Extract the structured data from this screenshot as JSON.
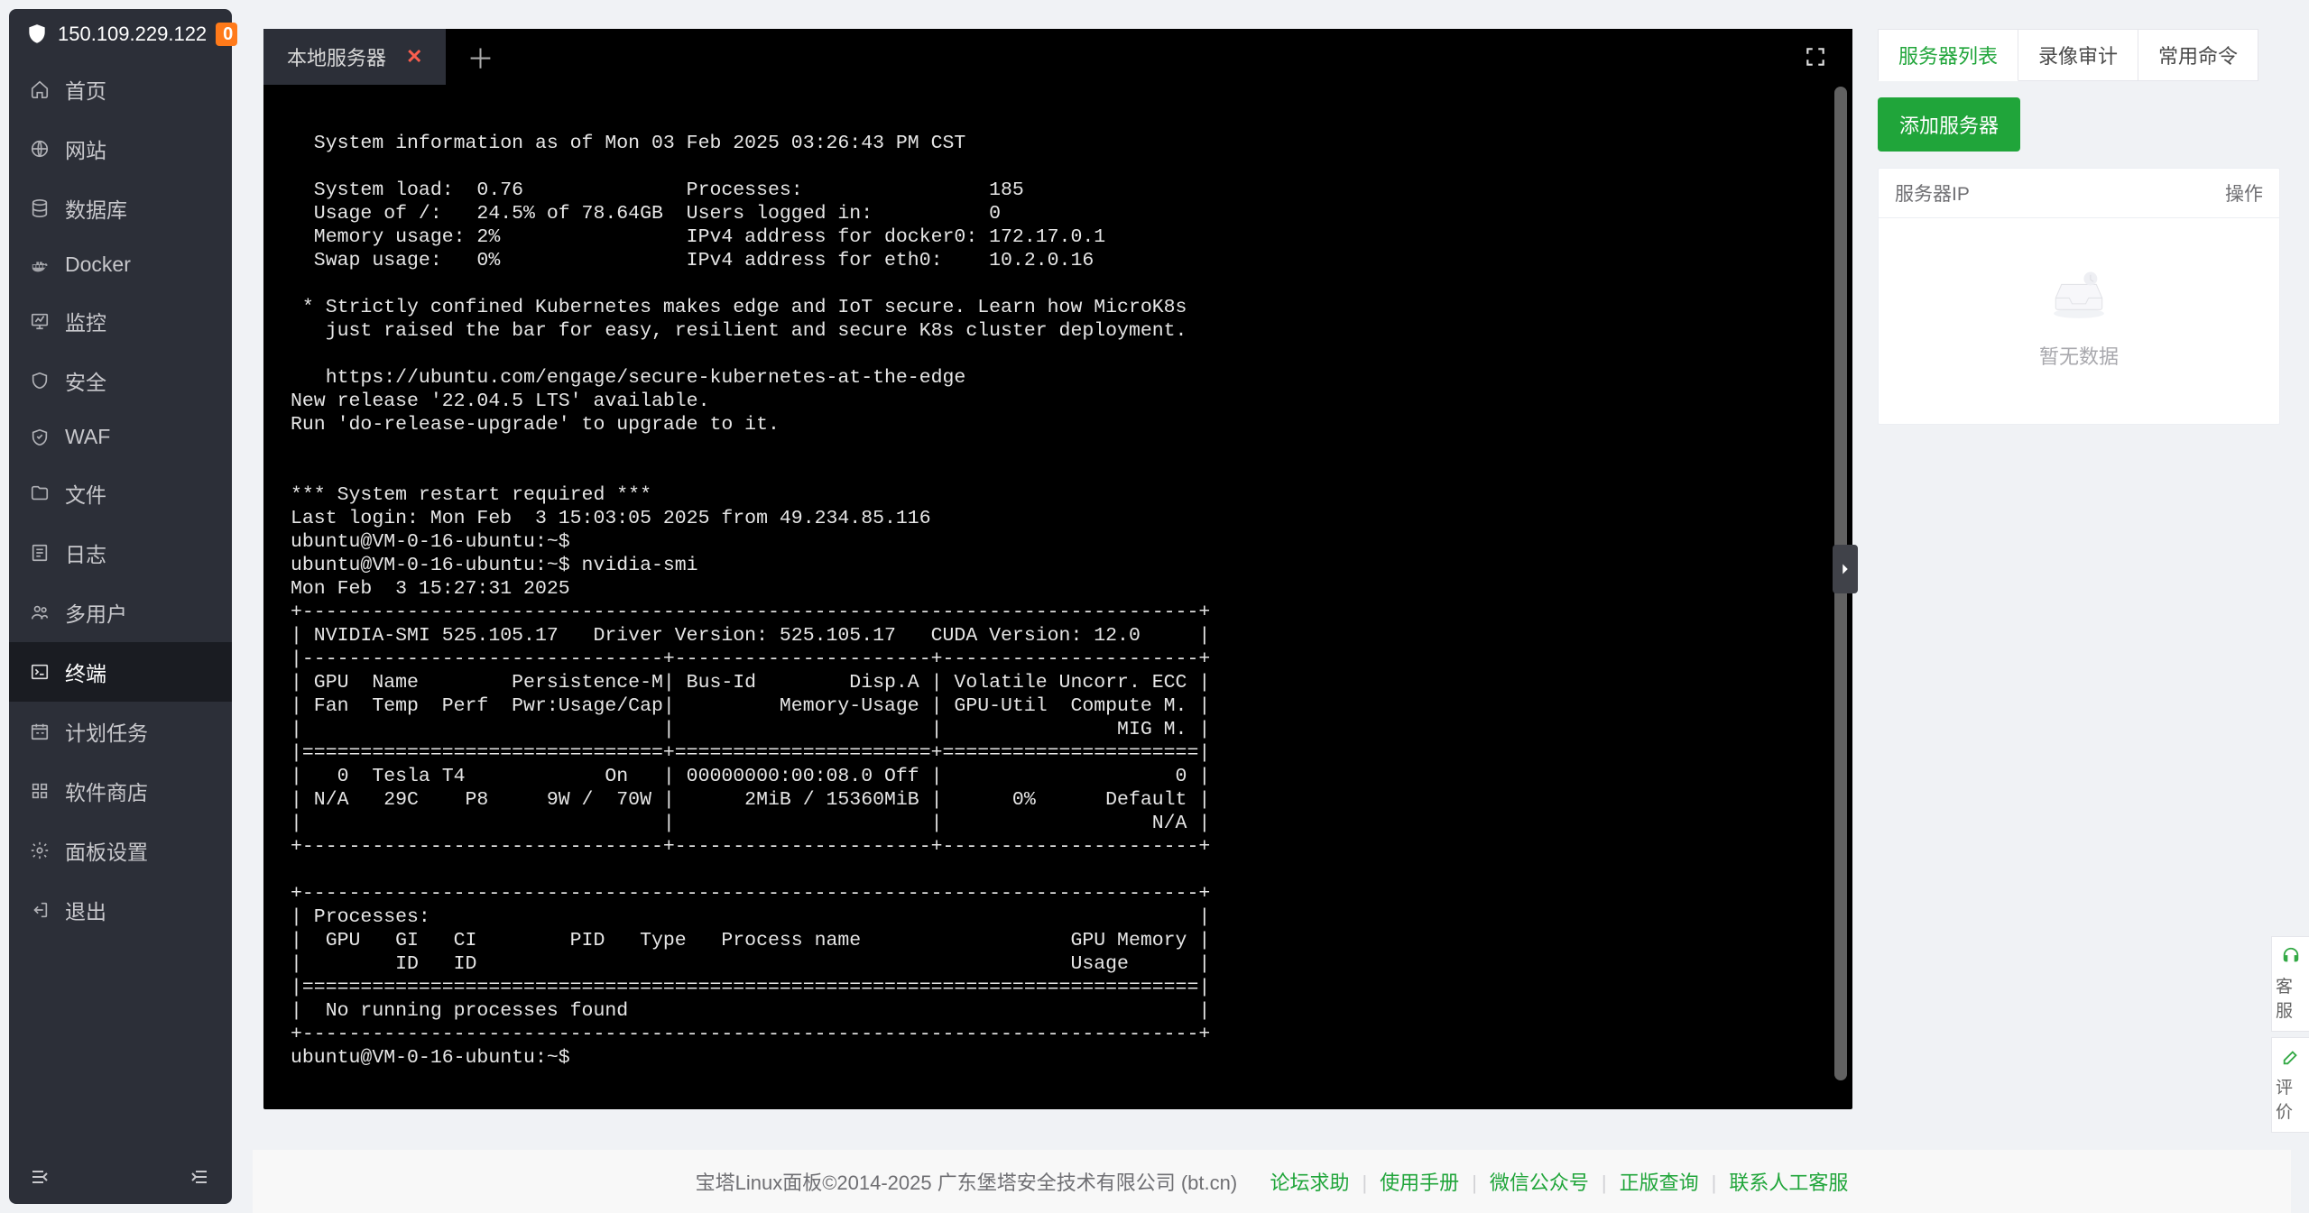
{
  "sidebar": {
    "ip": "150.109.229.122",
    "badge": "0",
    "items": [
      {
        "label": "首页",
        "icon": "home-icon"
      },
      {
        "label": "网站",
        "icon": "globe-icon"
      },
      {
        "label": "数据库",
        "icon": "database-icon"
      },
      {
        "label": "Docker",
        "icon": "docker-icon"
      },
      {
        "label": "监控",
        "icon": "monitor-icon"
      },
      {
        "label": "安全",
        "icon": "shield-icon"
      },
      {
        "label": "WAF",
        "icon": "waf-icon"
      },
      {
        "label": "文件",
        "icon": "folder-icon"
      },
      {
        "label": "日志",
        "icon": "log-icon"
      },
      {
        "label": "多用户",
        "icon": "users-icon"
      },
      {
        "label": "终端",
        "icon": "terminal-icon",
        "active": true
      },
      {
        "label": "计划任务",
        "icon": "schedule-icon"
      },
      {
        "label": "软件商店",
        "icon": "apps-icon"
      },
      {
        "label": "面板设置",
        "icon": "settings-icon"
      },
      {
        "label": "退出",
        "icon": "logout-icon"
      }
    ]
  },
  "terminal": {
    "tab_label": "本地服务器",
    "output": "\n  System information as of Mon 03 Feb 2025 03:26:43 PM CST\n\n  System load:  0.76              Processes:                185\n  Usage of /:   24.5% of 78.64GB  Users logged in:          0\n  Memory usage: 2%                IPv4 address for docker0: 172.17.0.1\n  Swap usage:   0%                IPv4 address for eth0:    10.2.0.16\n\n * Strictly confined Kubernetes makes edge and IoT secure. Learn how MicroK8s\n   just raised the bar for easy, resilient and secure K8s cluster deployment.\n\n   https://ubuntu.com/engage/secure-kubernetes-at-the-edge\nNew release '22.04.5 LTS' available.\nRun 'do-release-upgrade' to upgrade to it.\n\n\n*** System restart required ***\nLast login: Mon Feb  3 15:03:05 2025 from 49.234.85.116\nubuntu@VM-0-16-ubuntu:~$ \nubuntu@VM-0-16-ubuntu:~$ nvidia-smi\nMon Feb  3 15:27:31 2025       \n+-----------------------------------------------------------------------------+\n| NVIDIA-SMI 525.105.17   Driver Version: 525.105.17   CUDA Version: 12.0     |\n|-------------------------------+----------------------+----------------------+\n| GPU  Name        Persistence-M| Bus-Id        Disp.A | Volatile Uncorr. ECC |\n| Fan  Temp  Perf  Pwr:Usage/Cap|         Memory-Usage | GPU-Util  Compute M. |\n|                               |                      |               MIG M. |\n|===============================+======================+======================|\n|   0  Tesla T4            On   | 00000000:00:08.0 Off |                    0 |\n| N/A   29C    P8     9W /  70W |      2MiB / 15360MiB |      0%      Default |\n|                               |                      |                  N/A |\n+-------------------------------+----------------------+----------------------+\n                                                                               \n+-----------------------------------------------------------------------------+\n| Processes:                                                                  |\n|  GPU   GI   CI        PID   Type   Process name                  GPU Memory |\n|        ID   ID                                                   Usage      |\n|=============================================================================|\n|  No running processes found                                                 |\n+-----------------------------------------------------------------------------+\nubuntu@VM-0-16-ubuntu:~$ "
  },
  "right": {
    "tabs": [
      "服务器列表",
      "录像审计",
      "常用命令"
    ],
    "add_btn": "添加服务器",
    "col_ip": "服务器IP",
    "col_op": "操作",
    "empty": "暂无数据"
  },
  "footer": {
    "copyright": "宝塔Linux面板©2014-2025 广东堡塔安全技术有限公司 (bt.cn)",
    "links": [
      "论坛求助",
      "使用手册",
      "微信公众号",
      "正版查询",
      "联系人工客服"
    ]
  },
  "float": {
    "kefu": "客服",
    "pingjia": "评价"
  }
}
